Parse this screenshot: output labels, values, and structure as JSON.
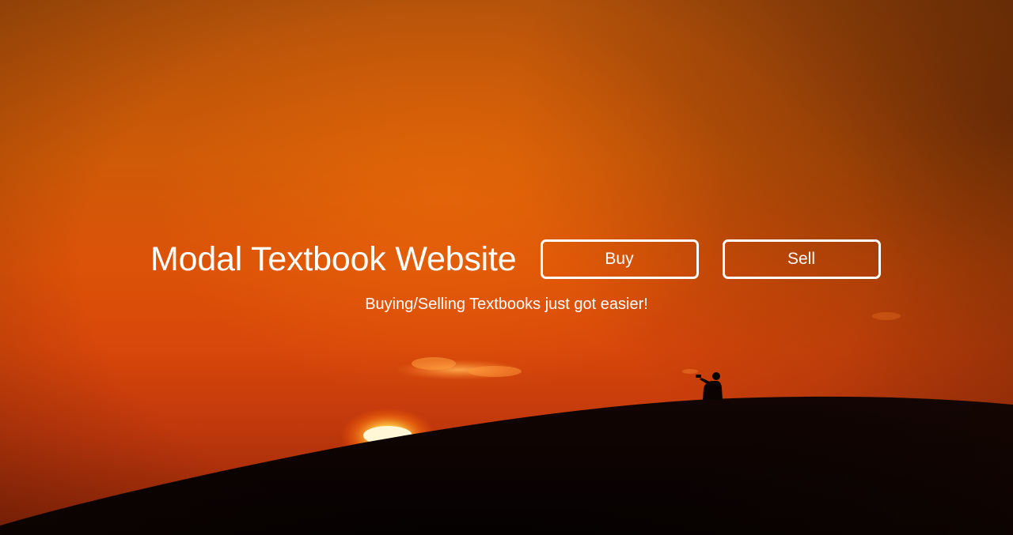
{
  "hero": {
    "title": "Modal Textbook Website",
    "tagline": "Buying/Selling Textbooks just got easier!",
    "buttons": {
      "buy_label": "Buy",
      "sell_label": "Sell"
    }
  },
  "colors": {
    "sky_top": "#b5530a",
    "sky_mid": "#dc5208",
    "sky_bottom": "#8e2508",
    "dune": "#0a0302",
    "sun": "#fff4c8",
    "text": "#ffffff"
  }
}
